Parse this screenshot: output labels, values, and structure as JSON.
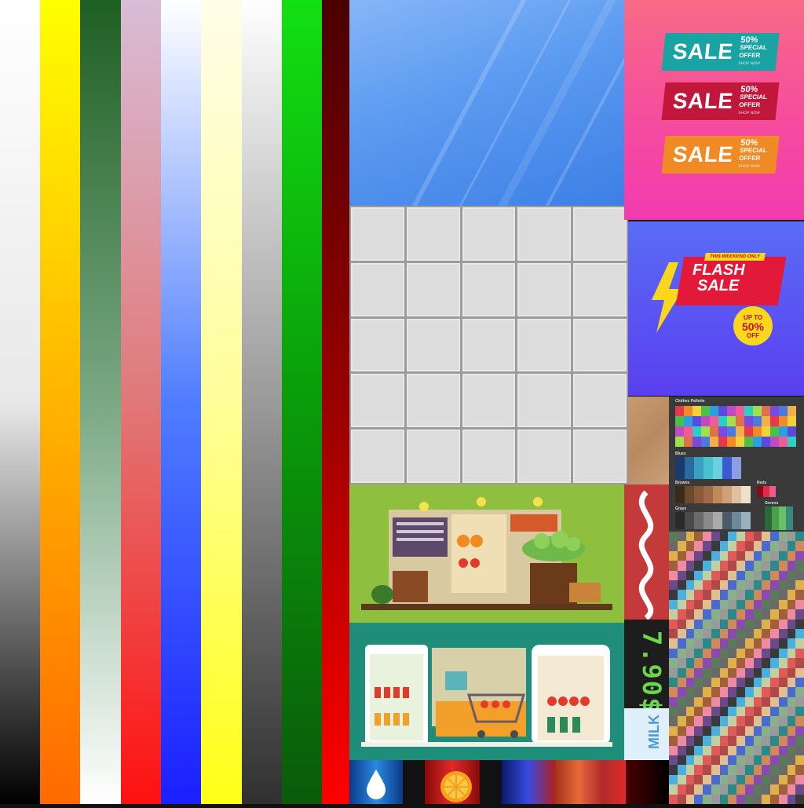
{
  "texture_atlas": {
    "gradient_stripes": [
      {
        "name": "white-to-black",
        "colors": [
          "#ffffff",
          "#e8e8e8",
          "#000000"
        ]
      },
      {
        "name": "yellow-to-orange",
        "colors": [
          "#ffff00",
          "#ffb400",
          "#ff6a00"
        ]
      },
      {
        "name": "dark-green-to-white",
        "colors": [
          "#1e5f23",
          "#7aa884",
          "#ffffff"
        ]
      },
      {
        "name": "lilac-to-red",
        "colors": [
          "#d8bdd6",
          "#e07878",
          "#ff1010"
        ]
      },
      {
        "name": "white-to-blue",
        "colors": [
          "#ffffff",
          "#4f7dff",
          "#1a1fff"
        ]
      },
      {
        "name": "cream-to-yellow",
        "colors": [
          "#fffde8",
          "#ffff9a",
          "#ffff18"
        ]
      },
      {
        "name": "white-to-dark-gray",
        "colors": [
          "#ffffff",
          "#9a9a9a",
          "#303030"
        ]
      },
      {
        "name": "green-to-dark-green",
        "colors": [
          "#12e012",
          "#0a9c0a",
          "#0a5a0a"
        ]
      },
      {
        "name": "maroon-to-red",
        "colors": [
          "#4a0000",
          "#990000",
          "#ff0000"
        ]
      }
    ],
    "sale_badges": [
      {
        "word": "SALE",
        "percent": "50%",
        "line1": "SPECIAL",
        "line2": "OFFER",
        "small": "SHOP NOW",
        "color": "#1aa3a3"
      },
      {
        "word": "SALE",
        "percent": "50%",
        "line1": "SPECIAL",
        "line2": "OFFER",
        "small": "SHOP NOW",
        "color": "#c2173c"
      },
      {
        "word": "SALE",
        "percent": "50%",
        "line1": "SPECIAL",
        "line2": "OFFER",
        "small": "SHOP NOW",
        "color": "#f08a24"
      }
    ],
    "flash_sale": {
      "kicker": "THIS WEEKEND ONLY",
      "line1": "FLASH",
      "line2": "SALE",
      "badge_top": "UP TO",
      "badge_value": "50%",
      "badge_bottom": "OFF"
    },
    "palette": {
      "title": "Clothes Pallette",
      "labels": {
        "blues": "Blues",
        "browns": "Browns",
        "reds": "Reds",
        "grays": "Grays",
        "greens": "Greens"
      }
    },
    "price_tag": "7.90$",
    "milk_label": "MILK"
  }
}
